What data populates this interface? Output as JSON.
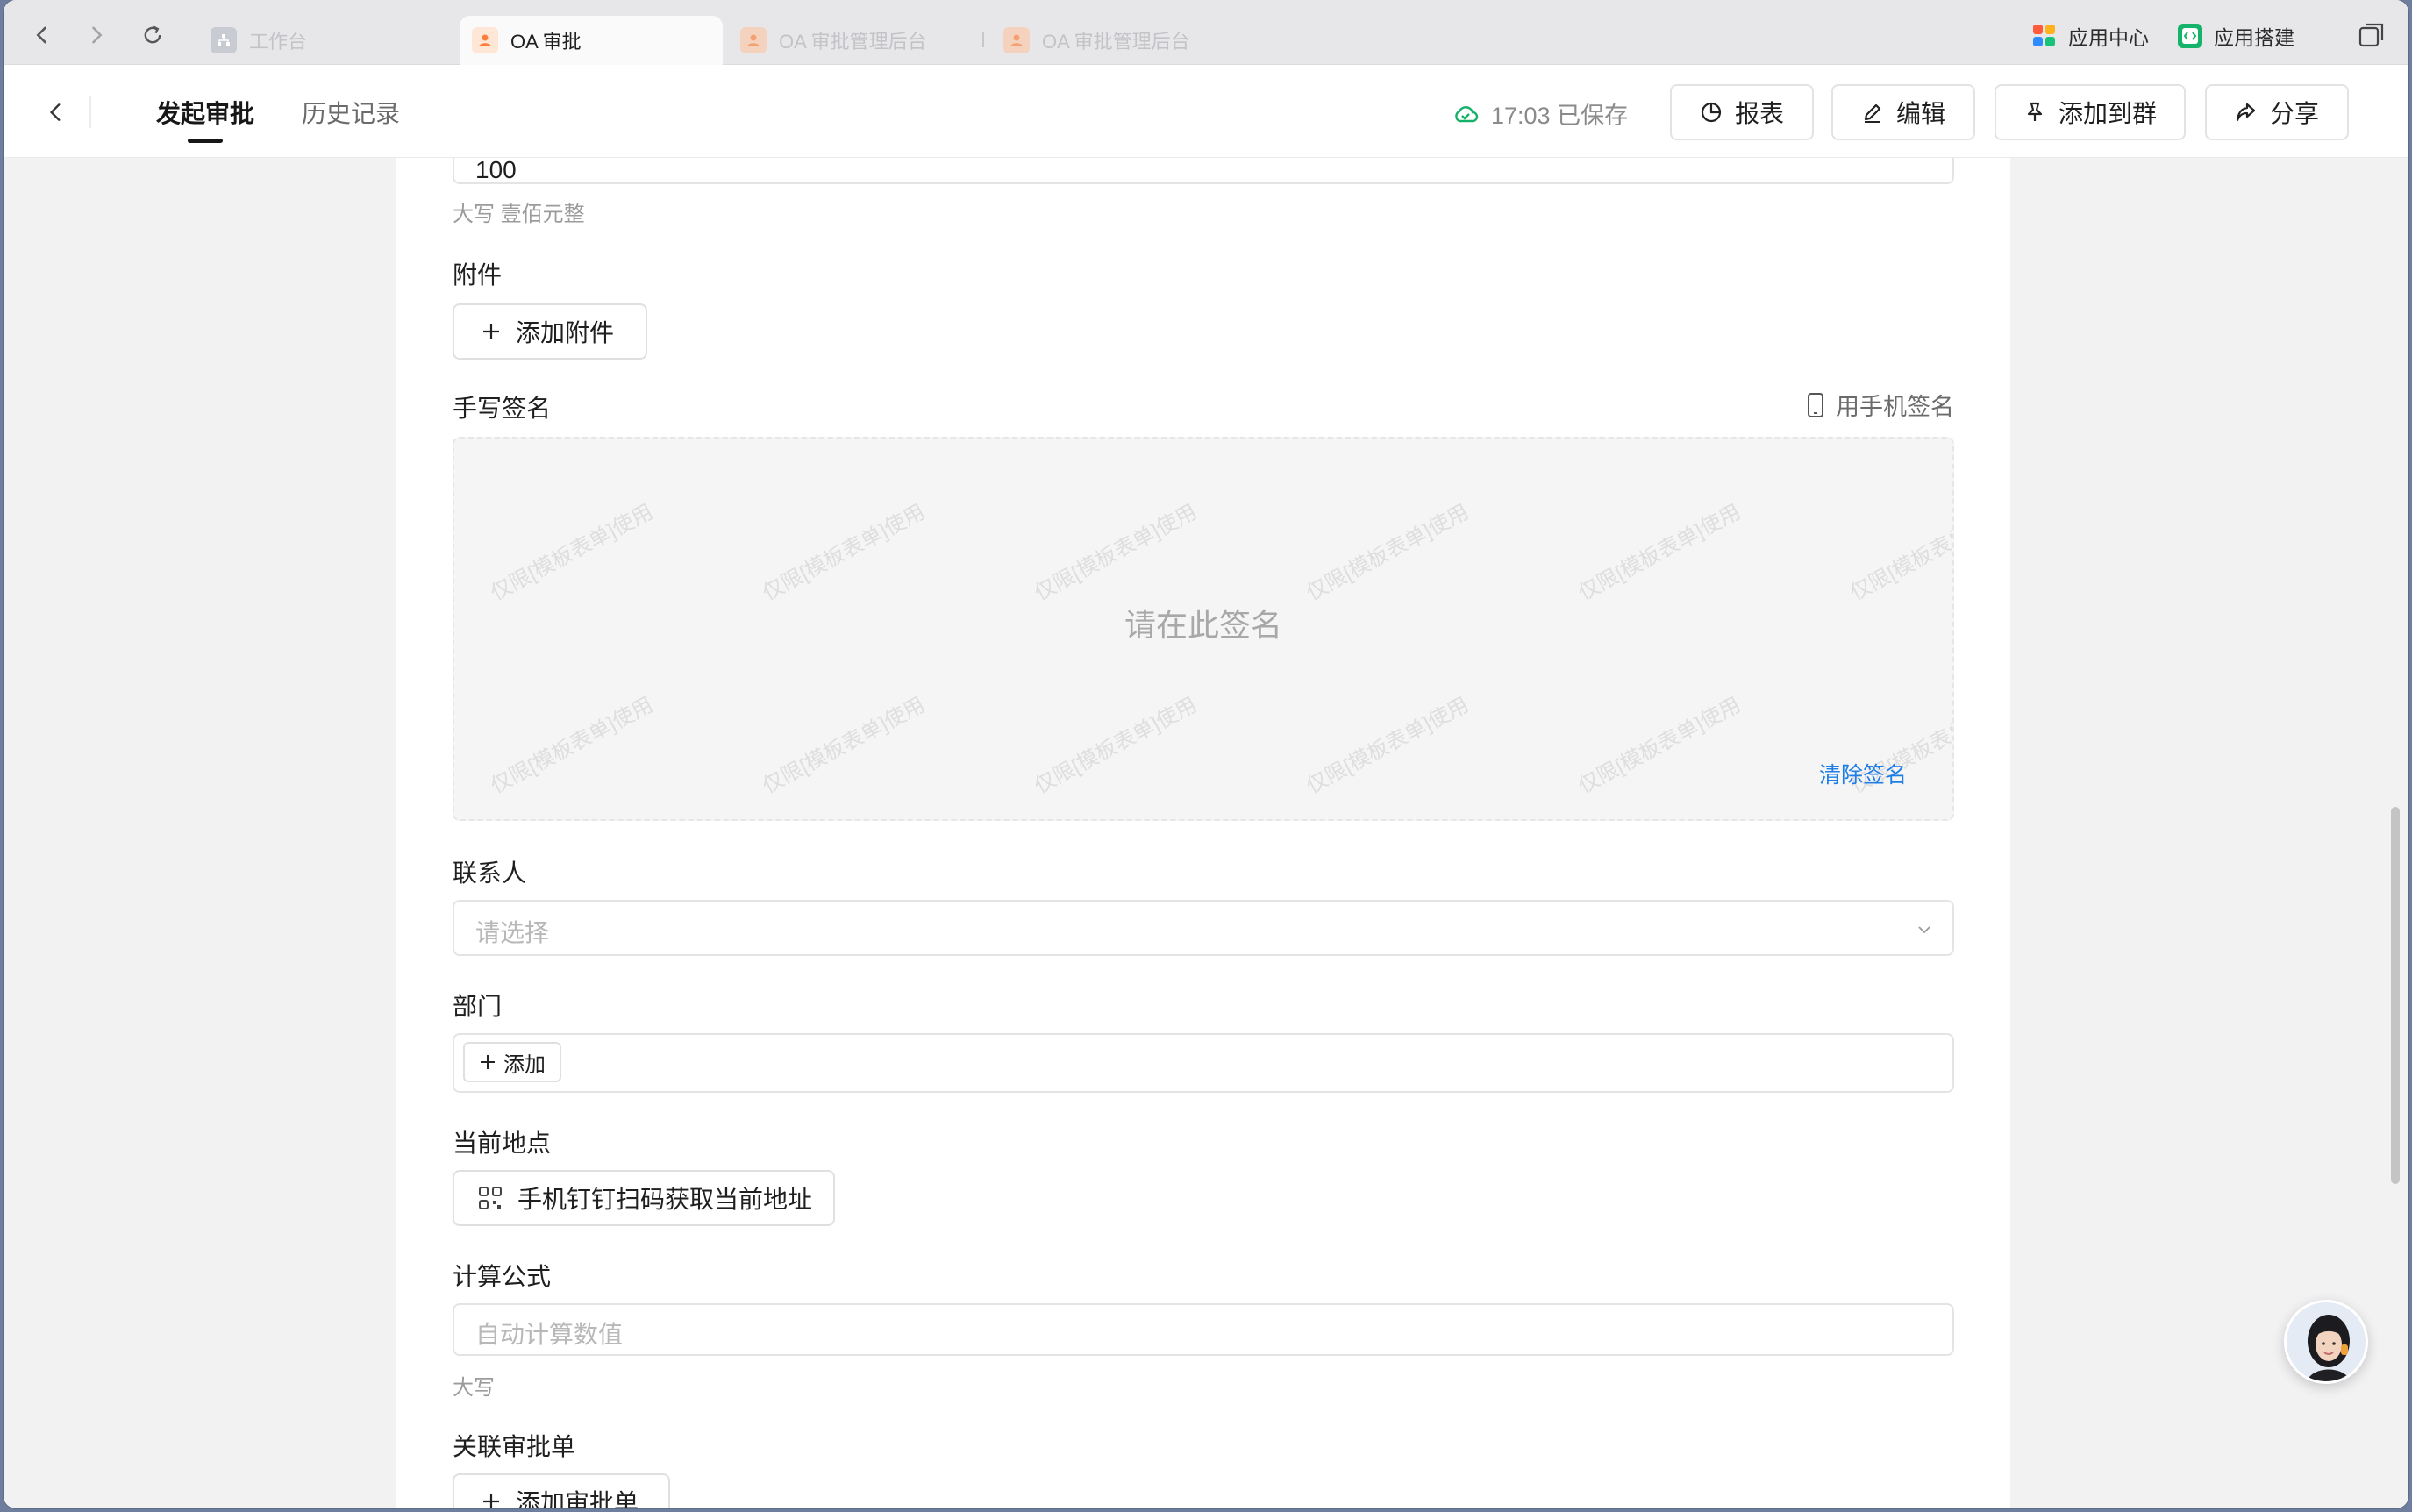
{
  "browser": {
    "tabs": [
      {
        "label": "工作台",
        "active": false
      },
      {
        "label": "OA 审批",
        "active": true
      },
      {
        "label": "OA 审批管理后台",
        "active": false
      },
      {
        "label": "OA 审批管理后台",
        "active": false
      }
    ],
    "app_center_label": "应用中心",
    "app_builder_label": "应用搭建"
  },
  "header": {
    "tabs": [
      "发起审批",
      "历史记录"
    ],
    "saved_text": "17:03 已保存",
    "buttons": {
      "report": "报表",
      "edit": "编辑",
      "add_to_group": "添加到群",
      "share": "分享"
    }
  },
  "form": {
    "amount_value": "100",
    "amount_uppercase": "大写  壹佰元整",
    "attachment": {
      "label": "附件",
      "button": "添加附件"
    },
    "signature": {
      "label": "手写签名",
      "phone_sign": "用手机签名",
      "placeholder": "请在此签名",
      "clear": "清除签名",
      "watermark": "仅限[模板表单]使用"
    },
    "contact": {
      "label": "联系人",
      "placeholder": "请选择"
    },
    "department": {
      "label": "部门",
      "add": "添加"
    },
    "location": {
      "label": "当前地点",
      "button": "手机钉钉扫码获取当前地址"
    },
    "formula": {
      "label": "计算公式",
      "placeholder": "自动计算数值",
      "uppercase": "大写"
    },
    "related": {
      "label": "关联审批单",
      "button": "添加审批单"
    }
  },
  "colors": {
    "accent_link": "#1e7ee6",
    "saved_icon": "#17b26a",
    "favicon": "#ff7d3a"
  }
}
